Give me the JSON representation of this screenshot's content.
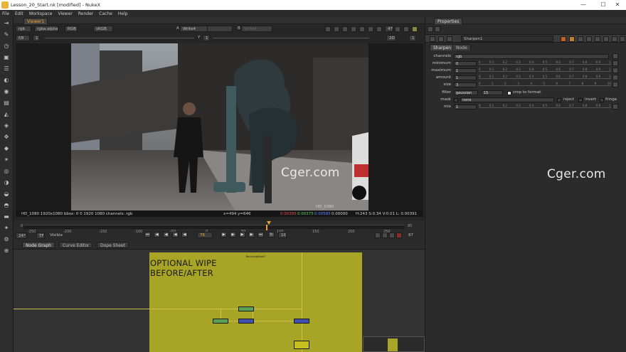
{
  "window": {
    "title": "Lesson_20_Start.nk [modified] - NukeX",
    "controls": [
      "—",
      "☐",
      "✕"
    ]
  },
  "menu": [
    "File",
    "Edit",
    "Workspace",
    "Viewer",
    "Render",
    "Cache",
    "Help"
  ],
  "viewer": {
    "tab": "Viewer1",
    "channels": "rgb",
    "alpha": "rgba.alpha",
    "display": "RGB",
    "colorspace": "sRGB",
    "input_a_label": "A",
    "input_a": "Write4",
    "input_b_label": "B",
    "input_b": "Write4",
    "frame_label": "f/8",
    "gain": "1",
    "gamma_label": "Y",
    "gamma": "1",
    "frame_num": "47",
    "zoom": "2D",
    "proxy": "1",
    "info_left": "HD_1080 1920x1080  bbox: 0 0 1920 1080 channels: rgb",
    "info_coords": "x=494 y=646",
    "info_r": "0.00385",
    "info_g": "0.00375",
    "info_b": "0.00585",
    "info_a": "0.00000",
    "info_hsv": "H:243 S:0.34 V:0.01  L: 0.00391",
    "format_label": "HD_1080"
  },
  "timeline": {
    "ticks": [
      "0",
      "-250",
      "-200",
      "-150",
      "-100",
      "-50",
      "0",
      "50",
      "100",
      "150",
      "200",
      "250"
    ],
    "start": "0",
    "end": "85",
    "fps": "24*",
    "tf": "TF",
    "mode": "Visible",
    "frame_field": "76",
    "step": "10",
    "end_field": "87"
  },
  "nodegraph": {
    "tabs": [
      "Node Graph",
      "Curve Editor",
      "Dope Sheet"
    ],
    "backdrop_label": "BackdropNode7",
    "backdrop_title_line1": "OPTIONAL WIPE",
    "backdrop_title_line2": "BEFORE/AFTER",
    "colors": {
      "backdrop": "#a8a526",
      "node_green": "#5aa05a",
      "node_blue": "#4050b0",
      "node_yellow": "#c8c020"
    }
  },
  "properties": {
    "tab": "Properties",
    "node_name": "Sharpen1",
    "sub_tabs": [
      "Sharpen",
      "Node"
    ],
    "channels_label": "channels",
    "channels_value": "rgb",
    "rows": [
      {
        "label": "minimum",
        "value": "0"
      },
      {
        "label": "maximum",
        "value": "1"
      },
      {
        "label": "amount",
        "value": "1"
      },
      {
        "label": "size",
        "value": "3"
      }
    ],
    "slider_ticks": [
      "0",
      "0.1",
      "0.2",
      "0.3",
      "0.4",
      "0.5",
      "0.6",
      "0.7",
      "0.8",
      "0.9",
      "1"
    ],
    "size_ticks": [
      "0",
      "1",
      "2",
      "3",
      "4",
      "5",
      "6",
      "7",
      "8",
      "9",
      "10"
    ],
    "filter_label": "filter",
    "filter_value": "gaussian",
    "filter_size": "15",
    "crop_label": "crop to format",
    "mask_label": "mask",
    "mask_value": "none",
    "inject_label": "inject",
    "invert_label": "invert",
    "fringe_label": "fringe",
    "mix_label": "mix",
    "mix_value": "1"
  },
  "watermarks": [
    "Cger.com",
    "Cger.com"
  ]
}
